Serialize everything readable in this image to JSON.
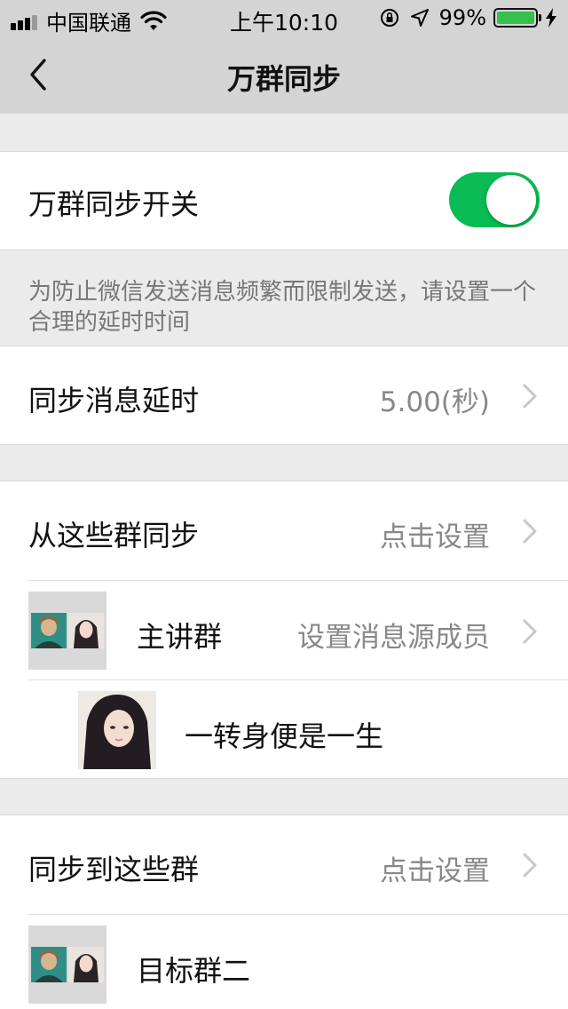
{
  "status_bar": {
    "carrier": "中国联通",
    "time": "上午10:10",
    "battery_text": "99%",
    "battery_level": 0.99,
    "signal_bars": 3
  },
  "nav": {
    "title": "万群同步",
    "back_icon": "chevron-left-icon"
  },
  "sync_switch": {
    "label": "万群同步开关",
    "enabled": true,
    "on_color": "#09bb52"
  },
  "hint": "为防止微信发送消息频繁而限制发送，请设置一个合理的延时时间",
  "delay": {
    "label": "同步消息延时",
    "value": "5.00(秒)"
  },
  "from_groups": {
    "label": "从这些群同步",
    "action": "点击设置",
    "groups": [
      {
        "name": "主讲群",
        "action": "设置消息源成员"
      }
    ],
    "members": [
      {
        "name": "一转身便是一生"
      }
    ]
  },
  "to_groups": {
    "label": "同步到这些群",
    "action": "点击设置",
    "groups": [
      {
        "name": "目标群二"
      }
    ]
  }
}
